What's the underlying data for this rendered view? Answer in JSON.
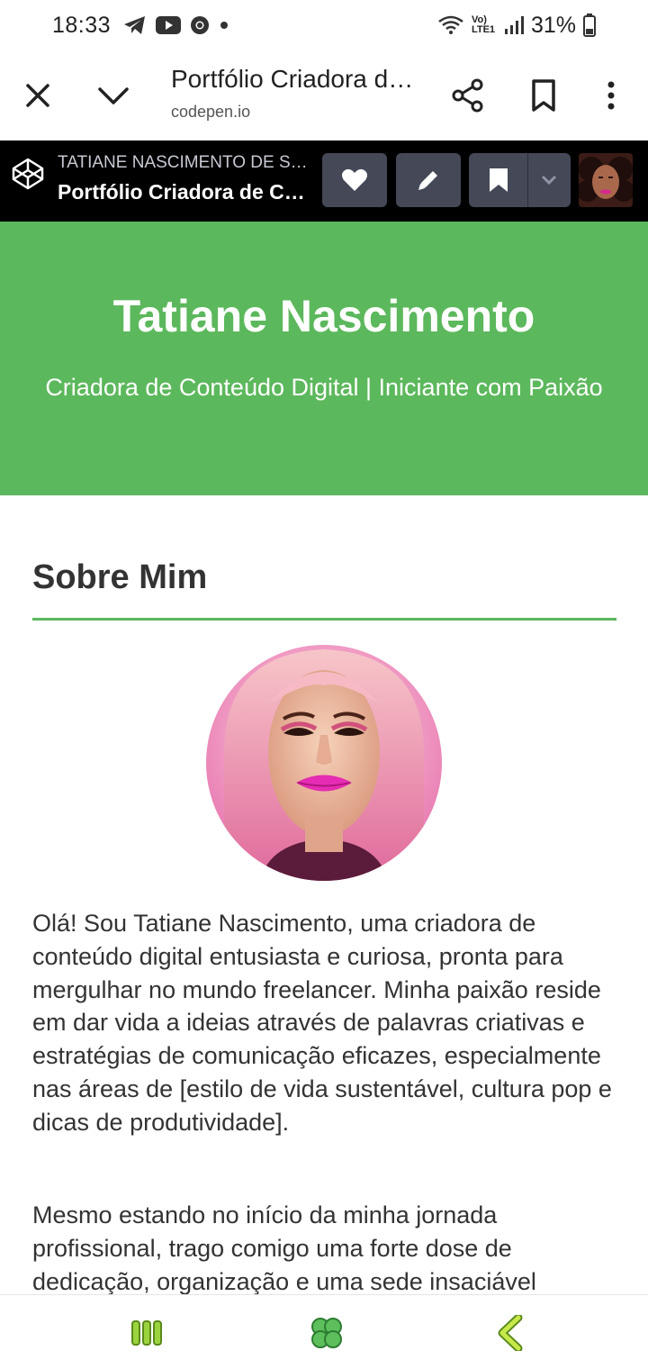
{
  "status_bar": {
    "time": "18:33",
    "battery": "31%",
    "icons": [
      "telegram-icon",
      "youtube-icon",
      "chrome-icon",
      "dot-icon",
      "wifi-icon",
      "volte-icon",
      "signal-icon",
      "battery-icon"
    ],
    "volte_label": "Vo) LTE1"
  },
  "browser": {
    "title": "Portfólio Criadora de Conteúdo Digital",
    "url": "codepen.io"
  },
  "codepen": {
    "author": "TATIANE NASCIMENTO DE SOUZA",
    "pen_title": "Portfólio Criadora de Conteúdo Digital",
    "button_bg": "#444857"
  },
  "hero": {
    "name": "Tatiane Nascimento",
    "subtitle": "Criadora de Conteúdo Digital | Iniciante com Paixão",
    "bg_color": "#5cb85c"
  },
  "about": {
    "heading": "Sobre Mim",
    "paragraph1": "Olá! Sou Tatiane Nascimento, uma criadora de conteúdo digital entusiasta e curiosa, pronta para mergulhar no mundo freelancer. Minha paixão reside em dar vida a ideias através de palavras criativas e estratégias de comunicação eficazes, especialmente nas áreas de [estilo de vida sustentável, cultura pop e dicas de produtividade].",
    "paragraph2": "Mesmo estando no início da minha jornada profissional, trago comigo uma forte dose de dedicação, organização e uma sede insaciável"
  },
  "nav": {
    "accent": "#9bd33f",
    "items": [
      "recent-apps-icon",
      "home-clover-icon",
      "back-icon"
    ]
  }
}
